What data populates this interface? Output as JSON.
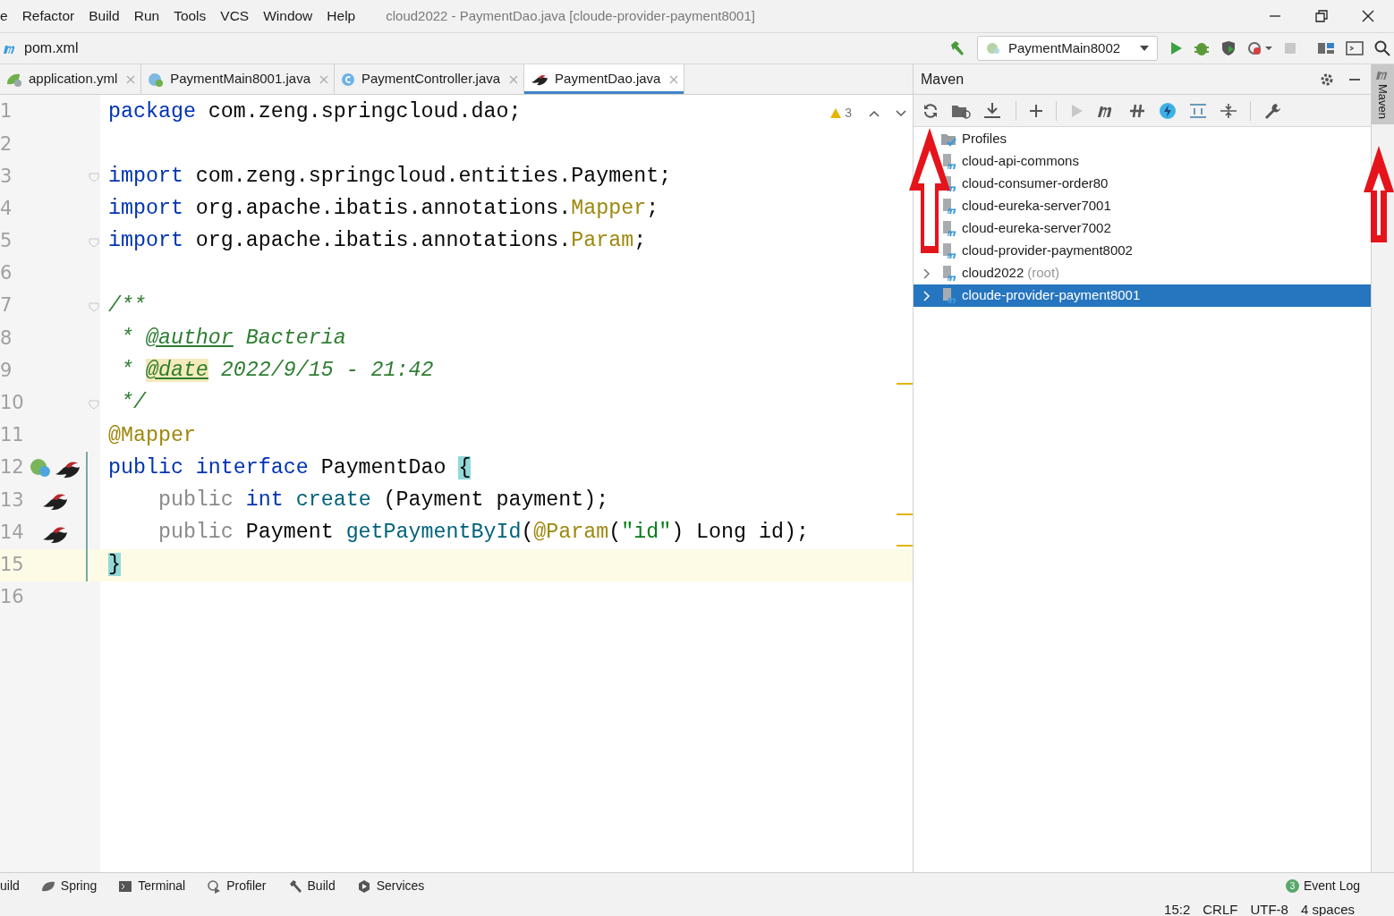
{
  "menu_bar": {
    "items": [
      "e",
      "Refactor",
      "Build",
      "Run",
      "Tools",
      "VCS",
      "Window",
      "Help"
    ],
    "title": "cloud2022 - PaymentDao.java [cloude-provider-payment8001]"
  },
  "nav_bar": {
    "breadcrumb": "pom.xml",
    "run_config": "PaymentMain8002"
  },
  "tabs": [
    {
      "label": "application.yml",
      "kind": "yml",
      "selected": false
    },
    {
      "label": "PaymentMain8001.java",
      "kind": "boot",
      "selected": false
    },
    {
      "label": "PaymentController.java",
      "kind": "class",
      "selected": false
    },
    {
      "label": "PaymentDao.java",
      "kind": "mapper",
      "selected": true
    }
  ],
  "editor": {
    "warning_count": "3",
    "lines": [
      {
        "number": "1",
        "current": false,
        "fold": false,
        "tokens": [
          {
            "text": "package",
            "kind": "kw"
          },
          {
            "text": " com.zeng.springcloud.dao;",
            "kind": "plain"
          }
        ]
      },
      {
        "number": "2",
        "current": false,
        "fold": false
      },
      {
        "number": "3",
        "current": false,
        "fold": true,
        "tokens": [
          {
            "text": "import",
            "kind": "kw"
          },
          {
            "text": " com.zeng.springcloud.entities.Payment;",
            "kind": "plain"
          }
        ]
      },
      {
        "number": "4",
        "current": false,
        "fold": false,
        "tokens": [
          {
            "text": "import",
            "kind": "kw"
          },
          {
            "text": " org.apache.ibatis.annotations.",
            "kind": "plain"
          },
          {
            "text": "Mapper",
            "kind": "ann"
          },
          {
            "text": ";",
            "kind": "plain"
          }
        ]
      },
      {
        "number": "5",
        "current": false,
        "fold": true,
        "tokens": [
          {
            "text": "import",
            "kind": "kw"
          },
          {
            "text": " org.apache.ibatis.annotations.",
            "kind": "plain"
          },
          {
            "text": "Param",
            "kind": "ann"
          },
          {
            "text": ";",
            "kind": "plain"
          }
        ]
      },
      {
        "number": "6",
        "current": false,
        "fold": false
      },
      {
        "number": "7",
        "current": false,
        "fold": true,
        "tokens": [
          {
            "text": "/**",
            "kind": "comment"
          }
        ]
      },
      {
        "number": "8",
        "current": false,
        "fold": false,
        "tokens": [
          {
            "text": " * ",
            "kind": "comment"
          },
          {
            "text": "@author",
            "kind": "tag"
          },
          {
            "text": " Bacteria",
            "kind": "comment"
          }
        ]
      },
      {
        "number": "9",
        "current": false,
        "fold": false,
        "tokens": [
          {
            "text": " * ",
            "kind": "comment"
          },
          {
            "text": "@date",
            "kind": "tag-hl"
          },
          {
            "text": " 2022/9/15 - 21:42",
            "kind": "comment"
          }
        ]
      },
      {
        "number": "10",
        "current": false,
        "fold": true,
        "tokens": [
          {
            "text": " */",
            "kind": "comment"
          }
        ]
      },
      {
        "number": "11",
        "current": false,
        "fold": false,
        "tokens": [
          {
            "text": "@Mapper",
            "kind": "ann"
          }
        ]
      },
      {
        "number": "12",
        "current": false,
        "fold": false,
        "gutter": [
          {
            "kind": "spring"
          },
          {
            "kind": "mapper"
          }
        ],
        "tokens": [
          {
            "text": "public",
            "kind": "kw"
          },
          {
            "text": " interface",
            "kind": "kw"
          },
          {
            "text": " PaymentDao ",
            "kind": "plain"
          },
          {
            "text": "{",
            "kind": "brace"
          }
        ]
      },
      {
        "number": "13",
        "current": false,
        "fold": false,
        "gutter": [
          {
            "kind": "mapper"
          }
        ],
        "tokens": [
          {
            "text": "    public ",
            "kind": "muted"
          },
          {
            "text": "int",
            "kind": "kw"
          },
          {
            "text": " create",
            "kind": "method"
          },
          {
            "text": " (Payment payment);",
            "kind": "plain"
          }
        ]
      },
      {
        "number": "14",
        "current": false,
        "fold": false,
        "gutter": [
          {
            "kind": "mapper"
          }
        ],
        "tokens": [
          {
            "text": "    public ",
            "kind": "muted"
          },
          {
            "text": "Payment ",
            "kind": "plain"
          },
          {
            "text": "getPaymentById",
            "kind": "method"
          },
          {
            "text": "(",
            "kind": "plain"
          },
          {
            "text": "@Param",
            "kind": "ann"
          },
          {
            "text": "(",
            "kind": "plain"
          },
          {
            "text": "\"id\"",
            "kind": "str"
          },
          {
            "text": ") Long id);",
            "kind": "plain"
          }
        ]
      },
      {
        "number": "15",
        "current": true,
        "fold": false,
        "tokens": [
          {
            "text": "}",
            "kind": "brace"
          }
        ]
      },
      {
        "number": "16",
        "current": false,
        "fold": false
      }
    ]
  },
  "maven": {
    "title": "Maven",
    "tree": [
      {
        "label": "Profiles",
        "kind": "profiles",
        "expandable": false,
        "selected": false
      },
      {
        "label": "cloud-api-commons",
        "kind": "module",
        "expandable": false,
        "selected": false
      },
      {
        "label": "cloud-consumer-order80",
        "kind": "module",
        "expandable": false,
        "selected": false
      },
      {
        "label": "cloud-eureka-server7001",
        "kind": "module",
        "expandable": false,
        "selected": false
      },
      {
        "label": "cloud-eureka-server7002",
        "kind": "module",
        "expandable": false,
        "selected": false
      },
      {
        "label": "cloud-provider-payment8002",
        "kind": "module",
        "expandable": false,
        "selected": false
      },
      {
        "label": "cloud2022",
        "suffix": "(root)",
        "kind": "module",
        "expandable": true,
        "selected": false
      },
      {
        "label": "cloude-provider-payment8001",
        "kind": "module",
        "expandable": true,
        "selected": true
      }
    ]
  },
  "right_strip": {
    "label": "Maven"
  },
  "tool_windows": [
    {
      "label": "uild",
      "kind": "none"
    },
    {
      "label": "Spring",
      "kind": "spring"
    },
    {
      "label": "Terminal",
      "kind": "terminal"
    },
    {
      "label": "Profiler",
      "kind": "profiler"
    },
    {
      "label": "Build",
      "kind": "hammer"
    },
    {
      "label": "Services",
      "kind": "services"
    }
  ],
  "event_log": {
    "count": "3",
    "label": "Event Log"
  },
  "status_bar": [
    "15:2",
    "CRLF",
    "UTF-8",
    "4 spaces"
  ]
}
